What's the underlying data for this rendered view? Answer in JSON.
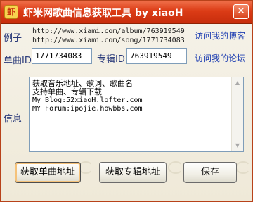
{
  "window": {
    "title": "虾米网歌曲信息获取工具 by xiaoH",
    "icon_text": "虾",
    "close_symbol": "✕"
  },
  "example": {
    "label": "例子",
    "url_album": "http://www.xiami.com/album/763919549",
    "url_song": "http://www.xiami.com/song/1771734083",
    "blog_link": "访问我的博客"
  },
  "song": {
    "label": "单曲ID",
    "value": "1771734083"
  },
  "album": {
    "label": "专辑ID",
    "value": "763919549"
  },
  "forum_link": "访问我的论坛",
  "info": {
    "label": "信息",
    "lines": [
      "获取音乐地址、歌词、歌曲名",
      "支持单曲、专辑下载",
      "My Blog:52xiaoH.lofter.com",
      "MY Forum:ipojie.howbbs.com"
    ]
  },
  "buttons": {
    "get_song": "获取单曲地址",
    "get_album": "获取专辑地址",
    "save": "保存"
  },
  "colors": {
    "titlebar": "#dc3c16",
    "label_text": "#2a3a7a",
    "link_text": "#1f3fb2"
  }
}
